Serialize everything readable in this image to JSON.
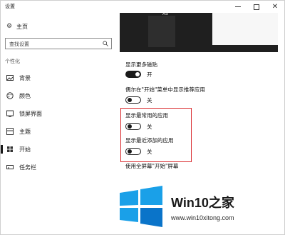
{
  "window": {
    "title": "设置"
  },
  "sidebar": {
    "home_label": "主页",
    "search_placeholder": "查找设置",
    "section_label": "个性化",
    "items": [
      {
        "label": "背景",
        "icon": "picture-icon"
      },
      {
        "label": "颜色",
        "icon": "palette-icon"
      },
      {
        "label": "锁屏界面",
        "icon": "lockscreen-icon"
      },
      {
        "label": "主题",
        "icon": "theme-icon"
      },
      {
        "label": "开始",
        "icon": "start-icon",
        "active": true
      },
      {
        "label": "任务栏",
        "icon": "taskbar-icon"
      }
    ]
  },
  "main": {
    "preview_sample": "Aa",
    "settings": [
      {
        "label": "显示更多磁贴",
        "state_label": "开",
        "on": true
      },
      {
        "label": "偶尔在\"开始\"菜单中显示推荐应用",
        "state_label": "关",
        "on": false
      },
      {
        "label": "显示最常用的应用",
        "state_label": "关",
        "on": false
      },
      {
        "label": "显示最近添加的应用",
        "state_label": "关",
        "on": false
      },
      {
        "label": "使用全屏幕\"开始\"屏幕",
        "state_label": "",
        "on": false
      }
    ]
  },
  "watermark": {
    "brand_left": "Win10",
    "brand_right": "之家",
    "url": "www.win10xitong.com",
    "logo_colors": [
      "#1aa0e8",
      "#0a74c9"
    ]
  },
  "colors": {
    "highlight_box": "#d8262a",
    "toggle_dark": "#1a1a1a"
  }
}
